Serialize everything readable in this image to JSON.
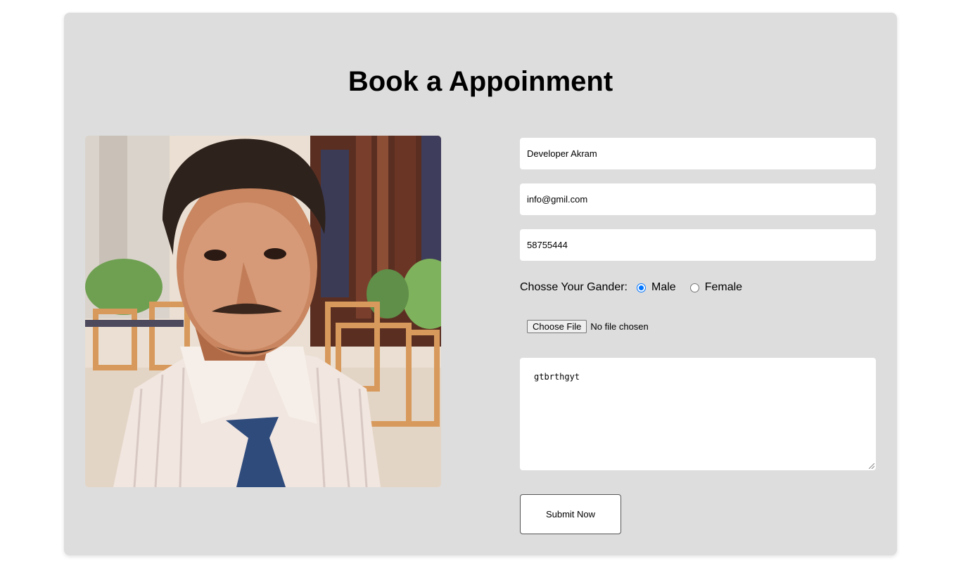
{
  "form": {
    "title": "Book a Appoinment",
    "name_value": "Developer Akram",
    "email_value": "info@gmil.com",
    "phone_value": "58755444",
    "gender_label": "Chosse Your Gander:",
    "gender_options": [
      "Male",
      "Female"
    ],
    "gender_selected": "Male",
    "file_button_label": "Choose File",
    "file_status": "No file chosen",
    "message_value": "gtbrthgyt",
    "submit_label": "Submit Now"
  },
  "colors": {
    "page_bg": "#ffffff",
    "card_bg": "#dddddd",
    "radio_accent": "#0075ff"
  }
}
